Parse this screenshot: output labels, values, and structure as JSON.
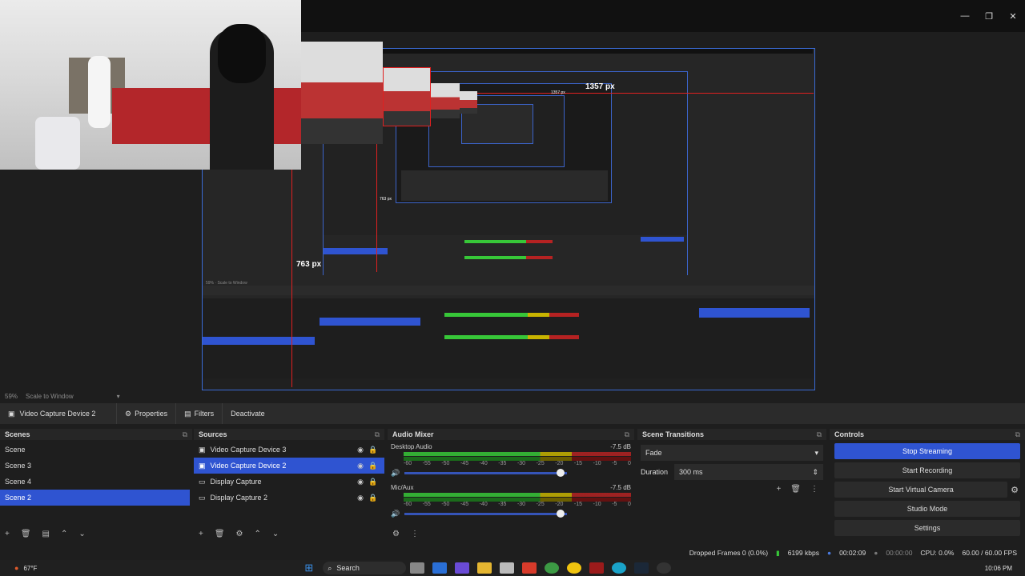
{
  "preview": {
    "width_label": "1357 px",
    "height_label": "763 px",
    "nested_width_label": "1357 px",
    "nested_height_label": "763 px"
  },
  "zoom": {
    "value": "59%",
    "label": "Scale to Window"
  },
  "context_bar": {
    "source_name": "Video Capture Device 2",
    "properties": "Properties",
    "filters": "Filters",
    "deactivate": "Deactivate"
  },
  "scenes": {
    "title": "Scenes",
    "items": [
      "Scene",
      "Scene 3",
      "Scene 4",
      "Scene 2"
    ],
    "selected": 3
  },
  "sources": {
    "title": "Sources",
    "items": [
      "Video Capture Device 3",
      "Video Capture Device 2",
      "Display Capture",
      "Display Capture 2"
    ],
    "selected": 1
  },
  "mixer": {
    "title": "Audio Mixer",
    "channels": [
      {
        "name": "Desktop Audio",
        "db": "-7.5 dB"
      },
      {
        "name": "Mic/Aux",
        "db": "-7.5 dB"
      }
    ],
    "ticks": [
      "-60",
      "-55",
      "-50",
      "-45",
      "-40",
      "-35",
      "-30",
      "-25",
      "-20",
      "-15",
      "-10",
      "-5",
      "0"
    ]
  },
  "transitions": {
    "title": "Scene Transitions",
    "type": "Fade",
    "duration_label": "Duration",
    "duration": "300 ms"
  },
  "controls": {
    "title": "Controls",
    "stop_streaming": "Stop Streaming",
    "start_recording": "Start Recording",
    "start_virtual_camera": "Start Virtual Camera",
    "studio_mode": "Studio Mode",
    "settings": "Settings"
  },
  "status": {
    "dropped": "Dropped Frames 0 (0.0%)",
    "bitrate": "6199 kbps",
    "stream_time": "00:02:09",
    "rec_time": "00:00:00",
    "cpu": "CPU: 0.0%",
    "fps": "60.00 / 60.00 FPS"
  },
  "taskbar": {
    "weather": "67°F",
    "search": "Search",
    "time": "10:06 PM"
  },
  "colors": {
    "accent": "#2f54d1",
    "red_guide": "#e02020",
    "meter_green": "#37c738"
  }
}
